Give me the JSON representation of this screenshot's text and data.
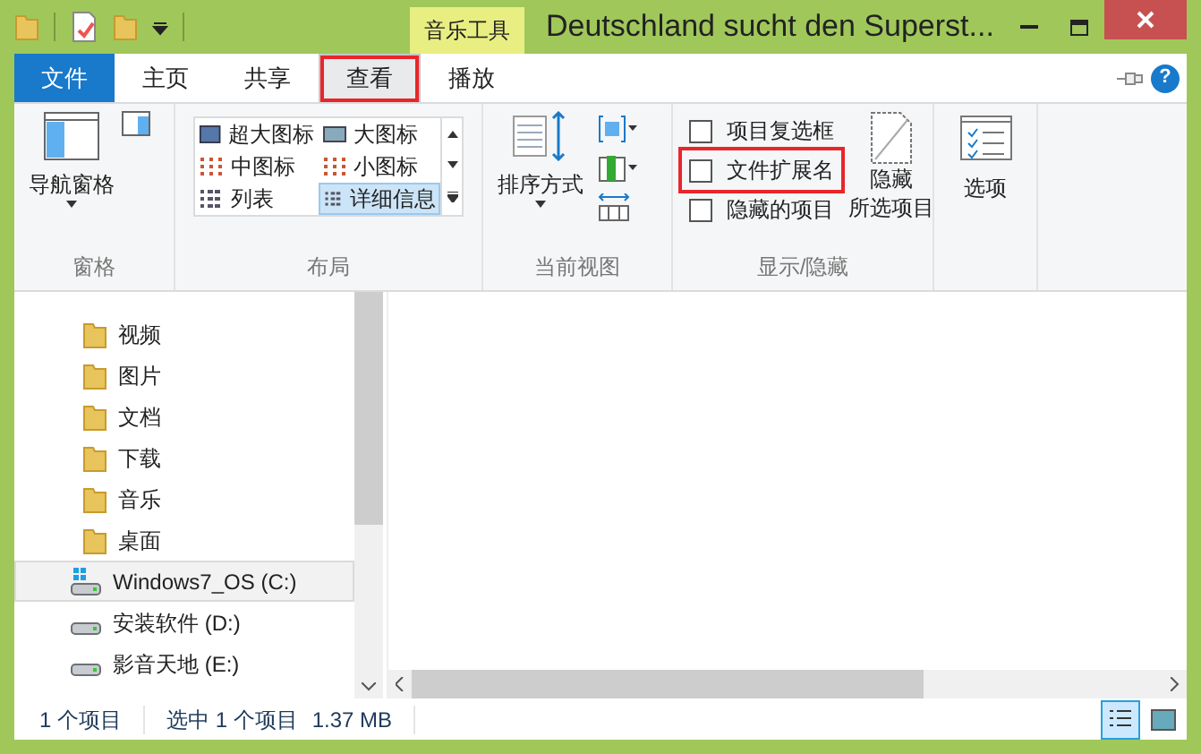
{
  "window": {
    "title": "Deutschland sucht den Superst...",
    "context_tab": "音乐工具",
    "help": "?"
  },
  "tabs": [
    {
      "label": "文件",
      "kind": "file",
      "selected": false,
      "highlighted": false
    },
    {
      "label": "主页",
      "kind": "tab",
      "selected": false,
      "highlighted": false
    },
    {
      "label": "共享",
      "kind": "tab",
      "selected": false,
      "highlighted": false
    },
    {
      "label": "查看",
      "kind": "tab",
      "selected": true,
      "highlighted": true
    },
    {
      "label": "播放",
      "kind": "tab",
      "selected": false,
      "highlighted": false
    }
  ],
  "ribbon": {
    "panes": {
      "label": "窗格",
      "nav_pane": "导航窗格"
    },
    "layout": {
      "label": "布局",
      "items": [
        {
          "label": "超大图标",
          "selected": false
        },
        {
          "label": "大图标",
          "selected": false
        },
        {
          "label": "中图标",
          "selected": false
        },
        {
          "label": "小图标",
          "selected": false
        },
        {
          "label": "列表",
          "selected": false
        },
        {
          "label": "详细信息",
          "selected": true
        }
      ]
    },
    "current_view": {
      "label": "当前视图",
      "sort": "排序方式"
    },
    "show_hide": {
      "label": "显示/隐藏",
      "checkboxes": [
        {
          "label": "项目复选框",
          "checked": false,
          "highlighted": false
        },
        {
          "label": "文件扩展名",
          "checked": false,
          "highlighted": true
        },
        {
          "label": "隐藏的项目",
          "checked": false,
          "highlighted": false
        }
      ],
      "hide_selected": [
        "隐藏",
        "所选项目"
      ]
    },
    "options": "选项"
  },
  "sidebar": {
    "items": [
      {
        "label": "视频",
        "kind": "folder",
        "selected": false
      },
      {
        "label": "图片",
        "kind": "folder",
        "selected": false
      },
      {
        "label": "文档",
        "kind": "folder",
        "selected": false
      },
      {
        "label": "下载",
        "kind": "folder",
        "selected": false
      },
      {
        "label": "音乐",
        "kind": "folder",
        "selected": false
      },
      {
        "label": "桌面",
        "kind": "folder",
        "selected": false
      },
      {
        "label": "Windows7_OS (C:)",
        "kind": "system-drive",
        "selected": true
      },
      {
        "label": "安装软件 (D:)",
        "kind": "drive",
        "selected": false
      },
      {
        "label": "影音天地 (E:)",
        "kind": "drive",
        "selected": false
      }
    ]
  },
  "status_bar": {
    "count": "1 个项目",
    "selection": "选中 1 个项目",
    "size": "1.37 MB",
    "views": [
      {
        "kind": "details",
        "selected": true
      },
      {
        "kind": "thumbnails",
        "selected": false
      }
    ]
  }
}
